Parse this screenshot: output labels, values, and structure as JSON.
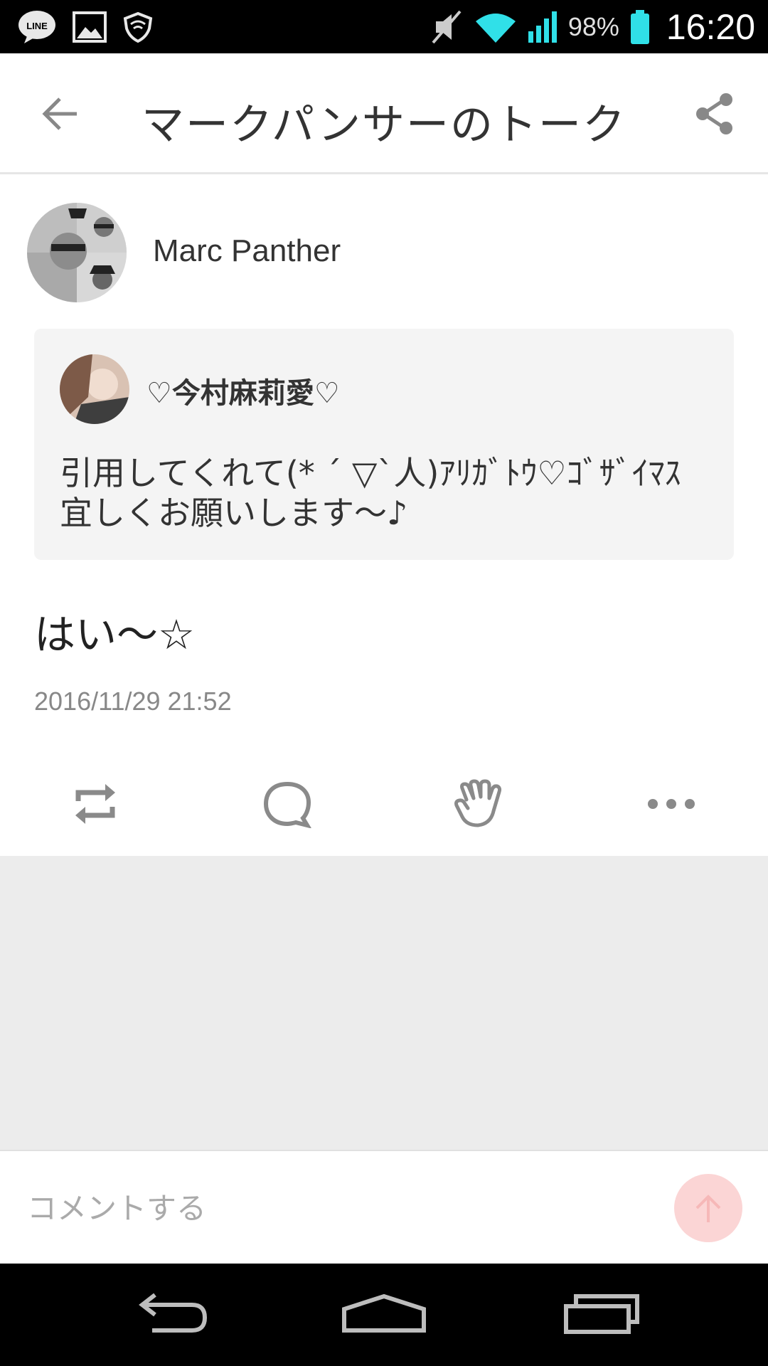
{
  "status_bar": {
    "battery_percent": "98%",
    "clock": "16:20",
    "left_icons": [
      "line-app-icon",
      "gallery-icon",
      "shield-icon"
    ],
    "right_icons": [
      "mute-icon",
      "wifi-icon",
      "signal-icon",
      "battery-icon"
    ],
    "battery_color": "#30e0e8"
  },
  "app_bar": {
    "title": "マークパンサーのトーク"
  },
  "post": {
    "author_name": "Marc Panther",
    "quote": {
      "author_name": "♡今村麻莉愛♡",
      "text": "引用してくれて(* ´ ▽`人)ｱﾘｶﾞﾄｳ♡ｺﾞｻﾞｲﾏｽ\n宜しくお願いします〜♪"
    },
    "body": "はい〜☆",
    "timestamp": "2016/11/29 21:52"
  },
  "actions": [
    "repost-icon",
    "comment-icon",
    "clap-icon",
    "more-icon"
  ],
  "comment": {
    "placeholder": "コメントする",
    "send_button_color": "#fbd5d5"
  },
  "colors": {
    "gray_area": "#ececec",
    "quote_bg": "#f4f4f4",
    "icon_gray": "#8a8a8a"
  }
}
